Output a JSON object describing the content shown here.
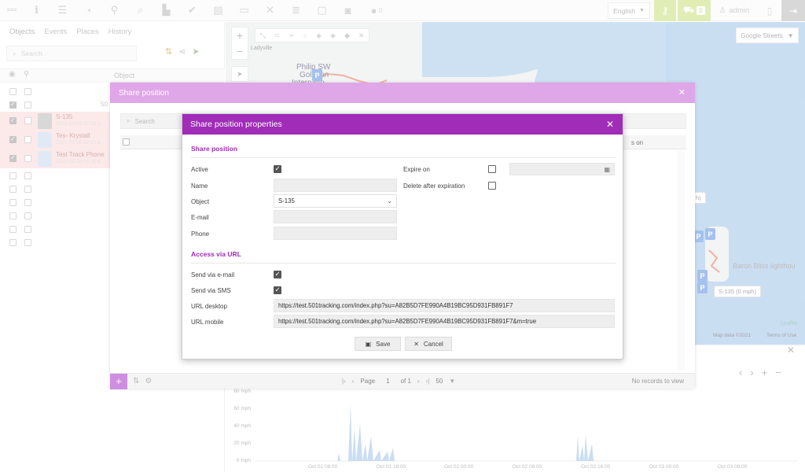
{
  "topbar": {
    "logo_text": "===",
    "events_count": "0",
    "language": "English",
    "cart_count": "0",
    "user": "admin"
  },
  "left_panel": {
    "tabs": [
      "Objects",
      "Events",
      "Places",
      "History"
    ],
    "search_placeholder": "Search",
    "column_object": "Object",
    "objects": [
      {
        "name": "",
        "sub": ""
      },
      {
        "name": "",
        "sub": "",
        "trailing": "50"
      },
      {
        "name": "S-135",
        "sub": "2021-10-03 15:28:1..."
      },
      {
        "name": "Tes- Krystall",
        "sub": "2021-09-06 09:23:1..."
      },
      {
        "name": "Test Track Phone",
        "sub": "2021-09-28 09:36:4..."
      }
    ]
  },
  "map": {
    "layer": "Google Streets",
    "labels": {
      "philip": "Philip SW",
      "goldson": "Goldson",
      "intl": "Internatio...",
      "ladyville": "Ladyville",
      "baron": "Baron Bliss lighthou",
      "tag_s135": "S-135 (0 mph)",
      "tag_small": "h)",
      "leaflet": "Leaflet",
      "mapdata": "Map data ©2021",
      "terms": "Terms of Use"
    }
  },
  "graph": {
    "y_labels": [
      "80 mph",
      "60 mph",
      "40 mph",
      "20 mph",
      "0 mph"
    ],
    "x_labels": [
      "Oct 01 08:00",
      "Oct 01 16:00",
      "Oct 02 00:00",
      "Oct 02 08:00",
      "Oct 02 16:00",
      "Oct 03 00:00",
      "Oct 03 08:00"
    ]
  },
  "share_dialog": {
    "title": "Share position",
    "search_placeholder": "Search",
    "col_right": "s on",
    "pager": {
      "page_label": "Page",
      "page": "1",
      "of": "of 1",
      "per_page": "50"
    },
    "no_records": "No records to view"
  },
  "properties_dialog": {
    "title": "Share position properties",
    "section_share": "Share position",
    "section_access": "Access via URL",
    "labels": {
      "active": "Active",
      "name": "Name",
      "object": "Object",
      "email": "E-mail",
      "phone": "Phone",
      "expire_on": "Expire on",
      "delete_after": "Delete after expiration",
      "send_email": "Send via e-mail",
      "send_sms": "Send via SMS",
      "url_desktop": "URL desktop",
      "url_mobile": "URL mobile"
    },
    "values": {
      "name": "",
      "object": "S-135",
      "email": "",
      "phone": "",
      "expire_date": "",
      "url_desktop": "https://test.501tracking.com/index.php?su=A82B5D7FE990A4B19BC95D931FB891F7",
      "url_mobile": "https://test.501tracking.com/index.php?su=A82B5D7FE990A4B19BC95D931FB891F7&m=true"
    },
    "save_label": "Save",
    "cancel_label": "Cancel"
  }
}
